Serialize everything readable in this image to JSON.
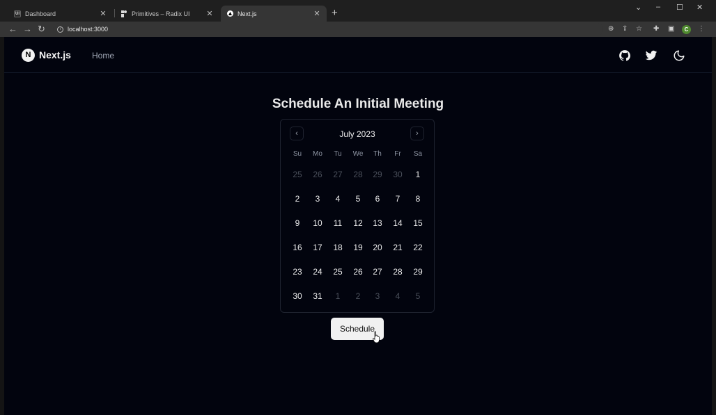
{
  "browser": {
    "tabs": [
      {
        "title": "Dashboard",
        "favicon": "UI",
        "active": false
      },
      {
        "title": "Primitives – Radix UI",
        "favicon": "radix-icon",
        "active": false
      },
      {
        "title": "Next.js",
        "favicon": "triangle-icon",
        "active": true
      }
    ],
    "address": "localhost:3000"
  },
  "header": {
    "logo_letter": "N",
    "brand": "Next.js",
    "nav": [
      "Home"
    ]
  },
  "page": {
    "title": "Schedule An Initial Meeting",
    "button": "Schedule"
  },
  "calendar": {
    "month": "July 2023",
    "weekdays": [
      "Su",
      "Mo",
      "Tu",
      "We",
      "Th",
      "Fr",
      "Sa"
    ],
    "weeks": [
      [
        {
          "d": "25",
          "o": true
        },
        {
          "d": "26",
          "o": true
        },
        {
          "d": "27",
          "o": true
        },
        {
          "d": "28",
          "o": true
        },
        {
          "d": "29",
          "o": true
        },
        {
          "d": "30",
          "o": true
        },
        {
          "d": "1",
          "o": false
        }
      ],
      [
        {
          "d": "2",
          "o": false
        },
        {
          "d": "3",
          "o": false
        },
        {
          "d": "4",
          "o": false
        },
        {
          "d": "5",
          "o": false
        },
        {
          "d": "6",
          "o": false
        },
        {
          "d": "7",
          "o": false
        },
        {
          "d": "8",
          "o": false
        }
      ],
      [
        {
          "d": "9",
          "o": false
        },
        {
          "d": "10",
          "o": false
        },
        {
          "d": "11",
          "o": false
        },
        {
          "d": "12",
          "o": false
        },
        {
          "d": "13",
          "o": false
        },
        {
          "d": "14",
          "o": false
        },
        {
          "d": "15",
          "o": false
        }
      ],
      [
        {
          "d": "16",
          "o": false
        },
        {
          "d": "17",
          "o": false
        },
        {
          "d": "18",
          "o": false
        },
        {
          "d": "19",
          "o": false
        },
        {
          "d": "20",
          "o": false
        },
        {
          "d": "21",
          "o": false
        },
        {
          "d": "22",
          "o": false
        }
      ],
      [
        {
          "d": "23",
          "o": false
        },
        {
          "d": "24",
          "o": false
        },
        {
          "d": "25",
          "o": false
        },
        {
          "d": "26",
          "o": false
        },
        {
          "d": "27",
          "o": false
        },
        {
          "d": "28",
          "o": false
        },
        {
          "d": "29",
          "o": false
        }
      ],
      [
        {
          "d": "30",
          "o": false
        },
        {
          "d": "31",
          "o": false
        },
        {
          "d": "1",
          "o": true
        },
        {
          "d": "2",
          "o": true
        },
        {
          "d": "3",
          "o": true
        },
        {
          "d": "4",
          "o": true
        },
        {
          "d": "5",
          "o": true
        }
      ]
    ]
  },
  "colors": {
    "page_bg": "#02040e",
    "button_bg": "#f1f1f1",
    "muted_day": "#4a4f5a"
  }
}
